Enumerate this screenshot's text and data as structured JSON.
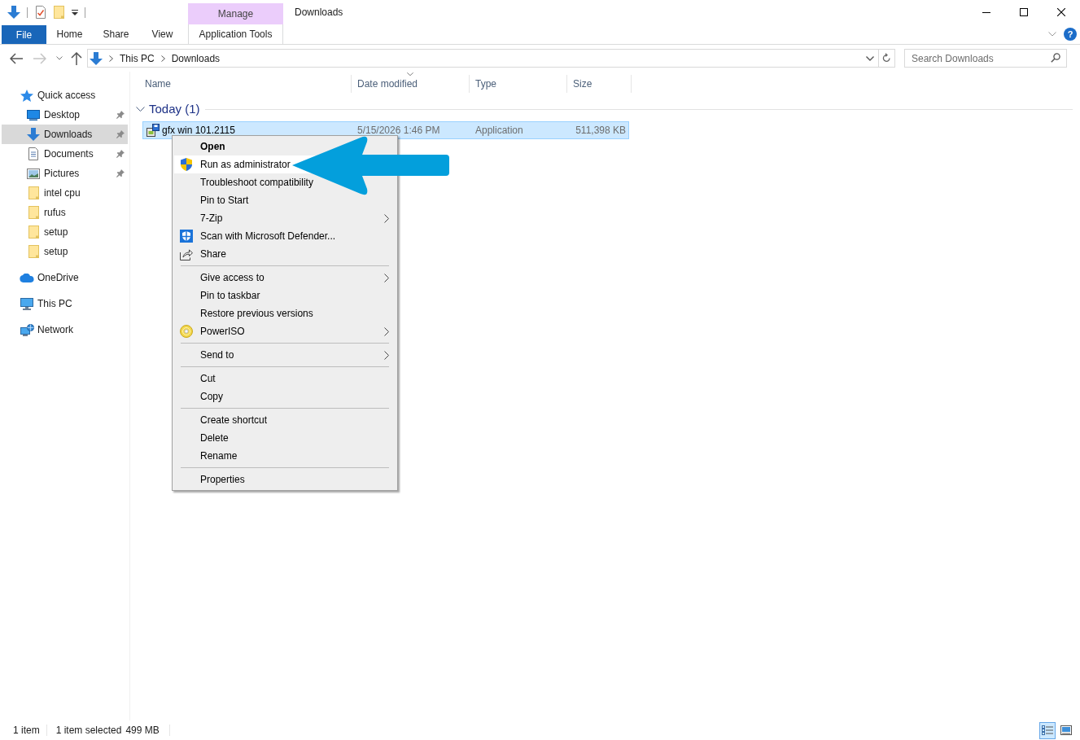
{
  "window": {
    "title": "Downloads"
  },
  "ribbon": {
    "contextual_header": "Manage",
    "tabs": [
      {
        "label": "File",
        "kind": "file",
        "selected": false
      },
      {
        "label": "Home",
        "kind": "standard",
        "selected": false
      },
      {
        "label": "Share",
        "kind": "standard",
        "selected": false
      },
      {
        "label": "View",
        "kind": "standard",
        "selected": false
      },
      {
        "label": "Application Tools",
        "kind": "contextual",
        "selected": false
      }
    ],
    "help": "?"
  },
  "address_bar": {
    "path": [
      "This PC",
      "Downloads"
    ]
  },
  "search": {
    "placeholder": "Search Downloads"
  },
  "navigation_pane": {
    "items": [
      {
        "label": "Quick access",
        "kind": "quick_access",
        "selected": false,
        "children": [
          {
            "label": "Desktop",
            "kind": "desktop",
            "pinned": true,
            "selected": false
          },
          {
            "label": "Downloads",
            "kind": "downloads",
            "pinned": true,
            "selected": true
          },
          {
            "label": "Documents",
            "kind": "documents",
            "pinned": true,
            "selected": false
          },
          {
            "label": "Pictures",
            "kind": "pictures",
            "pinned": true,
            "selected": false
          },
          {
            "label": "intel cpu",
            "kind": "folder",
            "pinned": false,
            "selected": false
          },
          {
            "label": "rufus",
            "kind": "folder",
            "pinned": false,
            "selected": false
          },
          {
            "label": "setup",
            "kind": "folder",
            "pinned": false,
            "selected": false
          },
          {
            "label": "setup",
            "kind": "folder",
            "pinned": false,
            "selected": false
          }
        ]
      },
      {
        "label": "OneDrive",
        "kind": "onedrive",
        "selected": false
      },
      {
        "label": "This PC",
        "kind": "this_pc",
        "selected": false
      },
      {
        "label": "Network",
        "kind": "network",
        "selected": false
      }
    ]
  },
  "file_list": {
    "columns": [
      {
        "label": "Name",
        "sorted": false
      },
      {
        "label": "Date modified",
        "sorted": true
      },
      {
        "label": "Type",
        "sorted": false
      },
      {
        "label": "Size",
        "sorted": false
      }
    ],
    "groups": [
      {
        "label": "Today (1)",
        "expanded": true,
        "rows": [
          {
            "name": "gfx win 101.2115",
            "date_modified": "5/15/2026 1:46 PM",
            "type": "Application",
            "size": "511,398 KB",
            "selected": true
          }
        ]
      }
    ]
  },
  "context_menu": {
    "items": [
      {
        "kind": "plain",
        "label": "Open",
        "default": true,
        "highlighted": false,
        "submenu": false
      },
      {
        "kind": "shield",
        "label": "Run as administrator",
        "default": false,
        "highlighted": true,
        "submenu": false
      },
      {
        "kind": "plain",
        "label": "Troubleshoot compatibility",
        "default": false,
        "highlighted": false,
        "submenu": false
      },
      {
        "kind": "plain",
        "label": "Pin to Start",
        "default": false,
        "highlighted": false,
        "submenu": false
      },
      {
        "kind": "plain",
        "label": "7-Zip",
        "default": false,
        "highlighted": false,
        "submenu": true
      },
      {
        "kind": "defender",
        "label": "Scan with Microsoft Defender...",
        "default": false,
        "highlighted": false,
        "submenu": false
      },
      {
        "kind": "share",
        "label": "Share",
        "default": false,
        "highlighted": false,
        "submenu": false
      },
      {
        "kind": "separator"
      },
      {
        "kind": "plain",
        "label": "Give access to",
        "default": false,
        "highlighted": false,
        "submenu": true
      },
      {
        "kind": "plain",
        "label": "Pin to taskbar",
        "default": false,
        "highlighted": false,
        "submenu": false
      },
      {
        "kind": "plain",
        "label": "Restore previous versions",
        "default": false,
        "highlighted": false,
        "submenu": false
      },
      {
        "kind": "poweriso",
        "label": "PowerISO",
        "default": false,
        "highlighted": false,
        "submenu": true
      },
      {
        "kind": "separator"
      },
      {
        "kind": "plain",
        "label": "Send to",
        "default": false,
        "highlighted": false,
        "submenu": true
      },
      {
        "kind": "separator"
      },
      {
        "kind": "plain",
        "label": "Cut",
        "default": false,
        "highlighted": false,
        "submenu": false
      },
      {
        "kind": "plain",
        "label": "Copy",
        "default": false,
        "highlighted": false,
        "submenu": false
      },
      {
        "kind": "separator"
      },
      {
        "kind": "plain",
        "label": "Create shortcut",
        "default": false,
        "highlighted": false,
        "submenu": false
      },
      {
        "kind": "plain",
        "label": "Delete",
        "default": false,
        "highlighted": false,
        "submenu": false
      },
      {
        "kind": "plain",
        "label": "Rename",
        "default": false,
        "highlighted": false,
        "submenu": false
      },
      {
        "kind": "separator"
      },
      {
        "kind": "plain",
        "label": "Properties",
        "default": false,
        "highlighted": false,
        "submenu": false
      }
    ]
  },
  "status_bar": {
    "item_count": "1 item",
    "selection": "1 item selected",
    "selection_size": "499 MB",
    "views": [
      {
        "kind": "details",
        "selected": true
      },
      {
        "kind": "large_icons",
        "selected": false
      }
    ]
  }
}
